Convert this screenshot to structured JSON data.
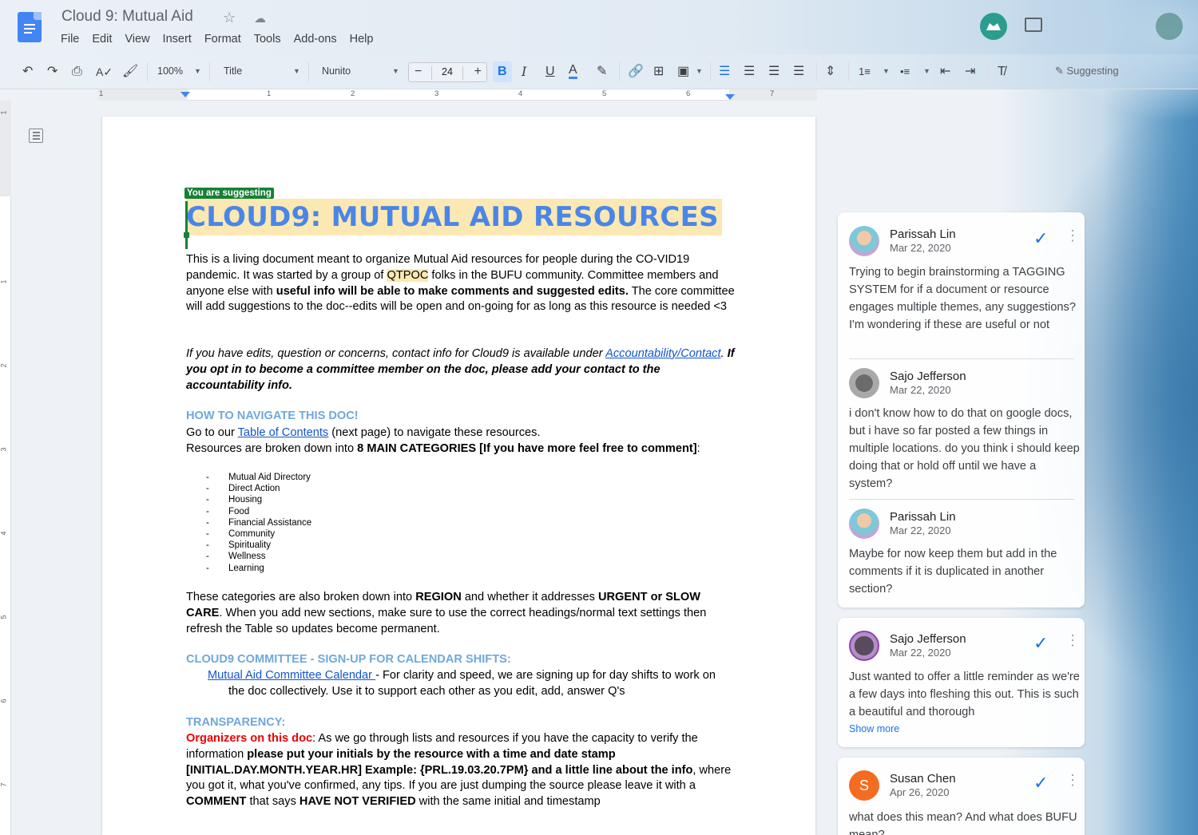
{
  "doc": {
    "title": "Cloud 9: Mutual Aid",
    "menu": [
      "File",
      "Edit",
      "View",
      "Insert",
      "Format",
      "Tools",
      "Add-ons",
      "Help"
    ]
  },
  "toolbar": {
    "zoom": "100%",
    "style": "Title",
    "font": "Nunito",
    "font_size": "24",
    "mode": "Suggesting",
    "accent": "#1a73e8"
  },
  "ruler": [
    "1",
    "1",
    "2",
    "3",
    "4",
    "5",
    "6",
    "7"
  ],
  "vruler": [
    "1",
    "1",
    "2",
    "3",
    "4",
    "5",
    "6",
    "7"
  ],
  "content": {
    "suggest_badge": "You are suggesting",
    "title": "CLOUD9: MUTUAL AID RESOURCES",
    "intro_1": "This is a living document meant to organize Mutual Aid resources for people during the CO-VID19 pandemic. It was started by a group of ",
    "intro_qtpoc": "QTPOC",
    "intro_2": " folks in the BUFU community. Committee members and anyone else with ",
    "intro_bold": "useful info will be able to make comments and suggested edits.",
    "intro_3": " The core committee will add suggestions to the doc--edits will be open and on-going for as long as this resource is needed <3",
    "edits_1": "If you have edits, question or concerns, contact info for Cloud9 is available under ",
    "edits_link": "Accountability/Contact",
    "edits_2": ". ",
    "edits_bold": "If you opt in to become a committee member on the doc, please add your contact to the accountability info.",
    "nav_heading": "HOW TO NAVIGATE THIS DOC!",
    "nav_1": "Go to our ",
    "nav_link": "Table of Contents",
    "nav_2": " (next page) to navigate these resources.",
    "nav_3": "Resources are broken down into ",
    "nav_bold": "8 MAIN CATEGORIES [If you have more feel free to comment]",
    "nav_4": ":",
    "categories": [
      "Mutual Aid Directory",
      "Direct Action",
      "Housing",
      "Food",
      "Financial Assistance",
      "Community",
      "Spirituality",
      "Wellness",
      "Learning"
    ],
    "regions_1": "These categories are also broken down into ",
    "regions_b1": "REGION",
    "regions_2": " and whether it addresses ",
    "regions_b2": "URGENT or SLOW CARE",
    "regions_3": ". When you add new sections, make sure to use the correct headings/normal text settings then refresh the Table so updates become permanent.",
    "committee_heading": "CLOUD9 COMMITTEE - SIGN-UP FOR CALENDAR SHIFTS:",
    "committee_link": "Mutual Aid Committee Calendar ",
    "committee_text": "- For clarity and speed, we are signing up for day shifts to work on the doc collectively. Use it to support each other as you edit, add, answer Q's",
    "transparency_heading": "TRANSPARENCY:",
    "trans_red": "Organizers on this doc",
    "trans_1": ": As we go through lists and resources if you have the capacity to verify the information ",
    "trans_b1": "please put your initials by the resource with a time and date stamp [INITIAL.DAY.MONTH.YEAR.HR] Example: {PRL.19.03.20.7PM} and a little line about the info",
    "trans_2": ", where you got it, what you've confirmed, any tips. If you are just dumping the source please leave it with a ",
    "trans_b2": "COMMENT",
    "trans_3": " that says ",
    "trans_b3": "HAVE NOT VERIFIED",
    "trans_4": " with the same initial and timestamp"
  },
  "comments": {
    "thread1": [
      {
        "name": "Parissah Lin",
        "date": "Mar 22, 2020",
        "text": "Trying to begin brainstorming a TAGGING SYSTEM for if a document or resource engages multiple themes, any suggestions? I'm wondering if these are useful or not"
      },
      {
        "name": "Sajo Jefferson",
        "date": "Mar 22, 2020",
        "text": "i don't know how to do that on google docs, but i have so far posted a few things in multiple locations. do you think i should keep doing that or hold off until we have a system?"
      },
      {
        "name": "Parissah Lin",
        "date": "Mar 22, 2020",
        "text": "Maybe for now keep them but add in the comments if it is duplicated in another section?"
      }
    ],
    "thread2": {
      "name": "Sajo Jefferson",
      "date": "Mar 22, 2020",
      "text": "Just wanted to offer a little reminder as we're a few days into fleshing this out. This is such a beautiful and thorough",
      "show_more": "Show more"
    },
    "thread3": {
      "name": "Susan Chen",
      "date": "Apr 26, 2020",
      "initial": "S",
      "text": "what does this mean? And what does BUFU mean?"
    }
  }
}
